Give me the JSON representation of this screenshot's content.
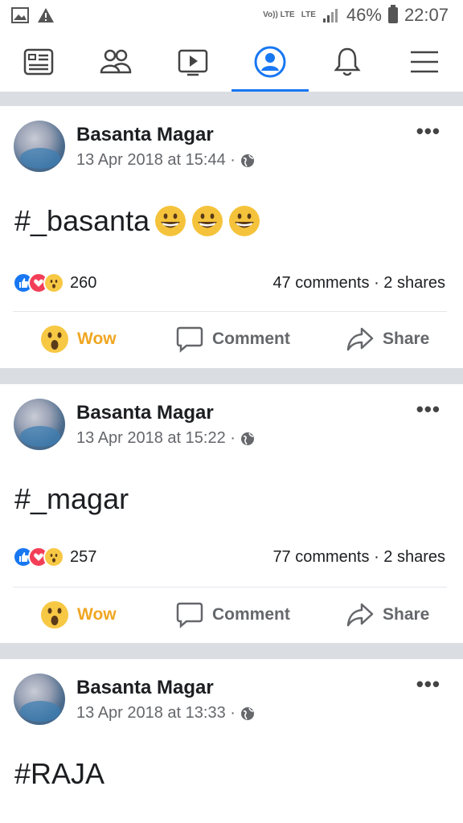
{
  "status_bar": {
    "network_top": "Vo)) LTE",
    "network_lte": "LTE",
    "battery": "46%",
    "time": "22:07"
  },
  "nav": {
    "items": [
      "feed-icon",
      "friends-icon",
      "watch-icon",
      "profile-icon",
      "notifications-icon",
      "menu-icon"
    ],
    "active": "profile-icon",
    "accent": "#1877f2"
  },
  "posts": [
    {
      "author": "Basanta Magar",
      "date": "13 Apr 2018 at 15:44 ·",
      "text": "#_basanta",
      "emoji_count": 3,
      "reaction_count": "260",
      "comments": "47 comments",
      "shares": "2 shares",
      "actions": [
        "Wow",
        "Comment",
        "Share"
      ]
    },
    {
      "author": "Basanta Magar",
      "date": "13 Apr 2018 at 15:22 ·",
      "text": "#_magar",
      "reaction_count": "257",
      "comments": "77 comments",
      "shares": "2 shares",
      "actions": [
        "Wow",
        "Comment",
        "Share"
      ]
    },
    {
      "author": "Basanta Magar",
      "date": "13 Apr 2018 at 13:33 ·",
      "text": "#RAJA"
    }
  ]
}
